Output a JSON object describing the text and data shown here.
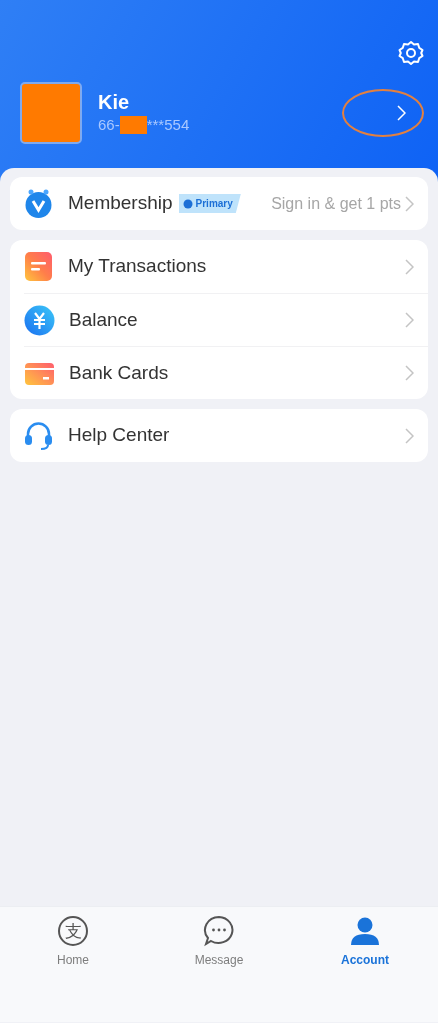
{
  "profile": {
    "name": "Kie",
    "phone_prefix": "66-",
    "phone_suffix": "***554"
  },
  "membership": {
    "label": "Membership",
    "badge": "Primary",
    "action": "Sign in & get 1 pts"
  },
  "menu_groups": [
    [
      {
        "label": "My Transactions",
        "kind": "transactions"
      },
      {
        "label": "Balance",
        "kind": "balance"
      },
      {
        "label": "Bank Cards",
        "kind": "cards"
      }
    ],
    [
      {
        "label": "Help Center",
        "kind": "help"
      }
    ]
  ],
  "tabs": [
    {
      "label": "Home",
      "kind": "home",
      "glyph": "支",
      "selected": false
    },
    {
      "label": "Message",
      "kind": "message",
      "selected": false
    },
    {
      "label": "Account",
      "kind": "account",
      "selected": true
    }
  ]
}
